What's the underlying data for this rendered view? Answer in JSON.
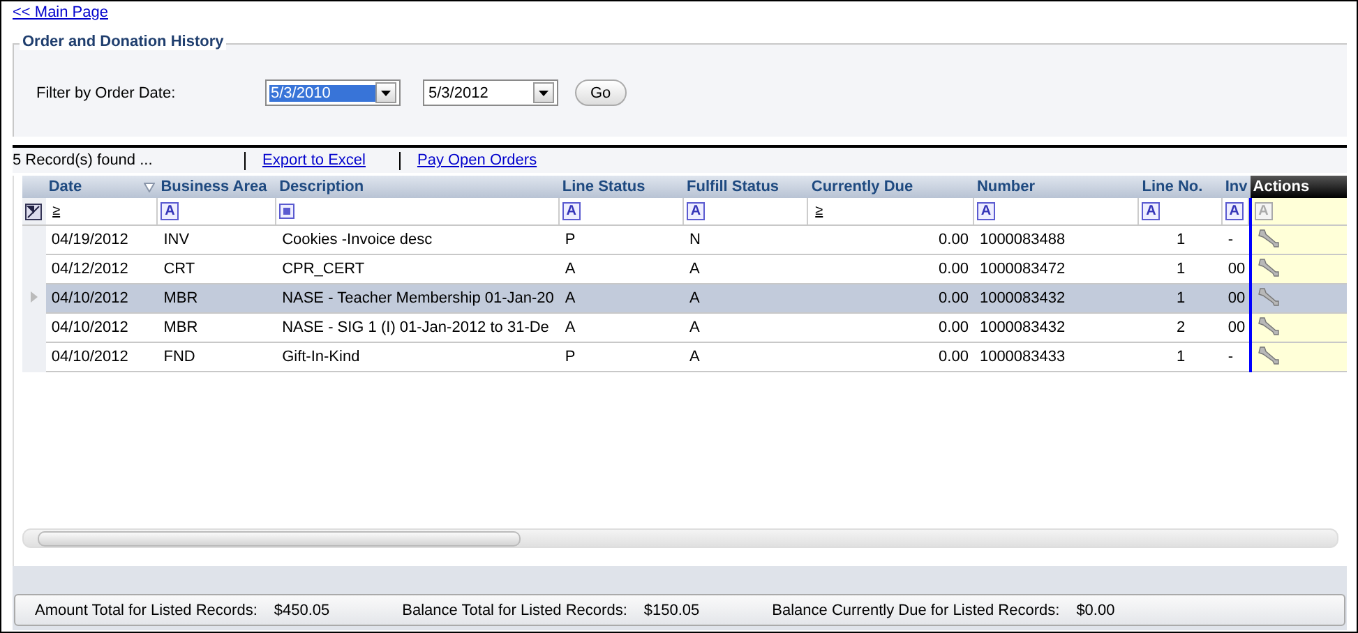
{
  "back_link": "<< Main Page",
  "section": {
    "title": "Order and Donation History"
  },
  "filter": {
    "label": "Filter by Order Date:",
    "from": {
      "value": "5/3/2010",
      "highlighted": true
    },
    "to": {
      "value": "5/3/2012",
      "highlighted": false
    },
    "button": "Go"
  },
  "toolbar": {
    "count": "5 Record(s) found ...",
    "links": [
      "Export to Excel",
      "Pay Open Orders"
    ]
  },
  "table": {
    "columns": [
      {
        "label": "Date",
        "filter": {
          "kind": "compare",
          "symbol": "≥"
        },
        "sort_indicator": true
      },
      {
        "label": "Business Area",
        "filter": {
          "kind": "letter",
          "symbol": "A"
        },
        "sort_indicator": false
      },
      {
        "label": "Description",
        "filter": {
          "kind": "square"
        },
        "sort_indicator": false
      },
      {
        "label": "Line Status",
        "filter": {
          "kind": "letter",
          "symbol": "A"
        },
        "sort_indicator": false
      },
      {
        "label": "Fulfill Status",
        "filter": {
          "kind": "letter",
          "symbol": "A"
        },
        "sort_indicator": false
      },
      {
        "label": "Currently Due",
        "filter": {
          "kind": "compare",
          "symbol": "≥"
        },
        "sort_indicator": false
      },
      {
        "label": "Number",
        "filter": {
          "kind": "letter",
          "symbol": "A"
        },
        "sort_indicator": false
      },
      {
        "label": "Line No.",
        "filter": {
          "kind": "letter",
          "symbol": "A"
        },
        "sort_indicator": false
      },
      {
        "label": "Inv",
        "filter": {
          "kind": "letter",
          "symbol": "A"
        },
        "sort_indicator": false
      }
    ],
    "actions_column": {
      "label": "Actions",
      "filter_symbol": "A",
      "filter_disabled": true
    },
    "rows": [
      {
        "selected": false,
        "cells": [
          "04/19/2012",
          "INV",
          "Cookies -Invoice desc",
          "P",
          "N",
          "0.00",
          "1000083488",
          "1",
          "-"
        ]
      },
      {
        "selected": false,
        "cells": [
          "04/12/2012",
          "CRT",
          "CPR_CERT",
          "A",
          "A",
          "0.00",
          "1000083472",
          "1",
          "00"
        ]
      },
      {
        "selected": true,
        "cells": [
          "04/10/2012",
          "MBR",
          "NASE - Teacher Membership 01-Jan-20",
          "A",
          "A",
          "0.00",
          "1000083432",
          "1",
          "00"
        ]
      },
      {
        "selected": false,
        "cells": [
          "04/10/2012",
          "MBR",
          "NASE - SIG 1 (I) 01-Jan-2012 to 31-De",
          "A",
          "A",
          "0.00",
          "1000083432",
          "2",
          "00"
        ]
      },
      {
        "selected": false,
        "cells": [
          "04/10/2012",
          "FND",
          "Gift-In-Kind",
          "P",
          "A",
          "0.00",
          "1000083433",
          "1",
          "-"
        ]
      }
    ]
  },
  "totals": [
    {
      "label": "Amount Total for Listed Records:",
      "value": "$450.05"
    },
    {
      "label": "Balance Total for Listed Records:",
      "value": "$150.05"
    },
    {
      "label": "Balance Currently Due for Listed Records:",
      "value": "$0.00"
    }
  ]
}
